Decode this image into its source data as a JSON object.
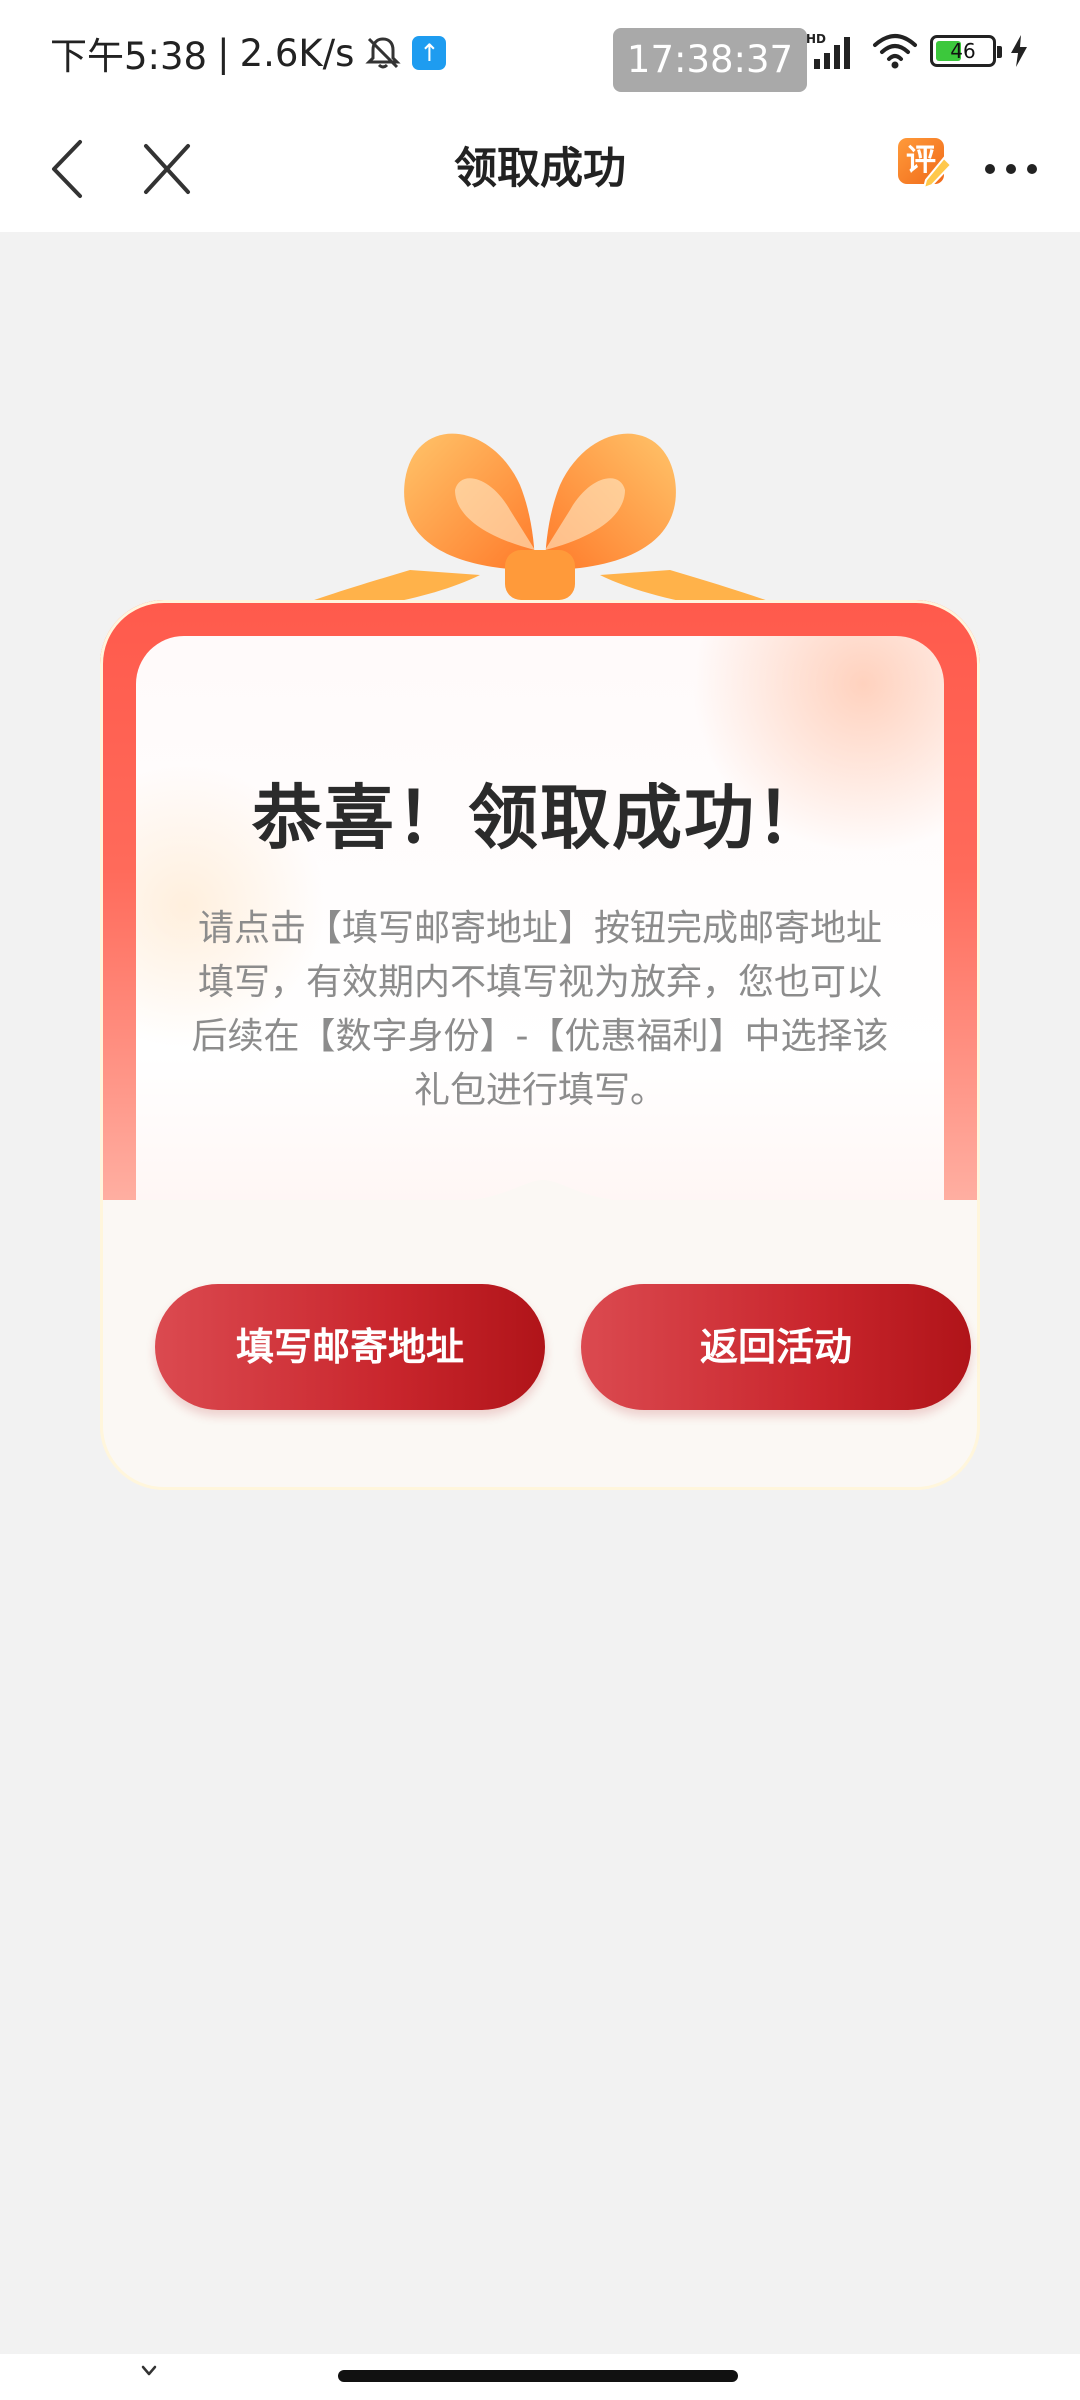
{
  "status_bar": {
    "time": "下午5:38",
    "separator": "|",
    "speed": "2.6K/s",
    "clock": "17:38:37",
    "network_badge": "HD",
    "battery_level": "46",
    "battery_fraction": 0.46,
    "battery_fill_color": "#3cc83c",
    "icons": [
      "bell-off-icon",
      "upload-icon",
      "signal-icon",
      "wifi-icon",
      "battery-icon",
      "charging-icon"
    ]
  },
  "nav": {
    "title": "领取成功",
    "rate_badge": "评",
    "icons": [
      "back-arrow-icon",
      "close-icon",
      "rate-icon",
      "more-icon"
    ]
  },
  "card": {
    "title": "恭喜！领取成功！",
    "description": "请点击【填写邮寄地址】按钮完成邮寄地址填写，有效期内不填写视为放弃，您也可以后续在【数字身份】-【优惠福利】中选择该礼包进行填写。",
    "buttons": {
      "fill_address": "填写邮寄地址",
      "back_to_activity": "返回活动"
    },
    "accent_color": "#c9262d",
    "frame_color": "#ff5a4c"
  }
}
